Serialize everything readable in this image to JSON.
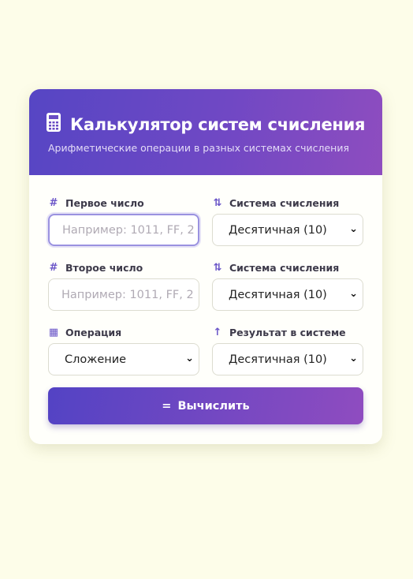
{
  "header": {
    "icon": "calculator-icon",
    "title": "Калькулятор систем счисления",
    "subtitle": "Арифметические операции в разных системах счисления"
  },
  "form": {
    "first_number": {
      "label": "Первое число",
      "icon": "hash-icon",
      "value": "",
      "placeholder": "Например: 1011, FF, 2"
    },
    "first_base": {
      "label": "Система счисления",
      "icon": "sort-numeric-icon",
      "selected": "Десятичная (10)"
    },
    "second_number": {
      "label": "Второе число",
      "icon": "hash-icon",
      "value": "",
      "placeholder": "Например: 1011, FF, 2"
    },
    "second_base": {
      "label": "Система счисления",
      "icon": "sort-numeric-icon",
      "selected": "Десятичная (10)"
    },
    "operation": {
      "label": "Операция",
      "icon": "calculator-icon",
      "selected": "Сложение"
    },
    "result_base": {
      "label": "Результат в системе",
      "icon": "arrow-up-icon",
      "selected": "Десятичная (10)"
    },
    "submit": {
      "label": "Вычислить",
      "icon": "equals-icon"
    }
  },
  "colors": {
    "accent_start": "#5343c4",
    "accent_end": "#8f4cc0",
    "background": "#fdfde9"
  }
}
